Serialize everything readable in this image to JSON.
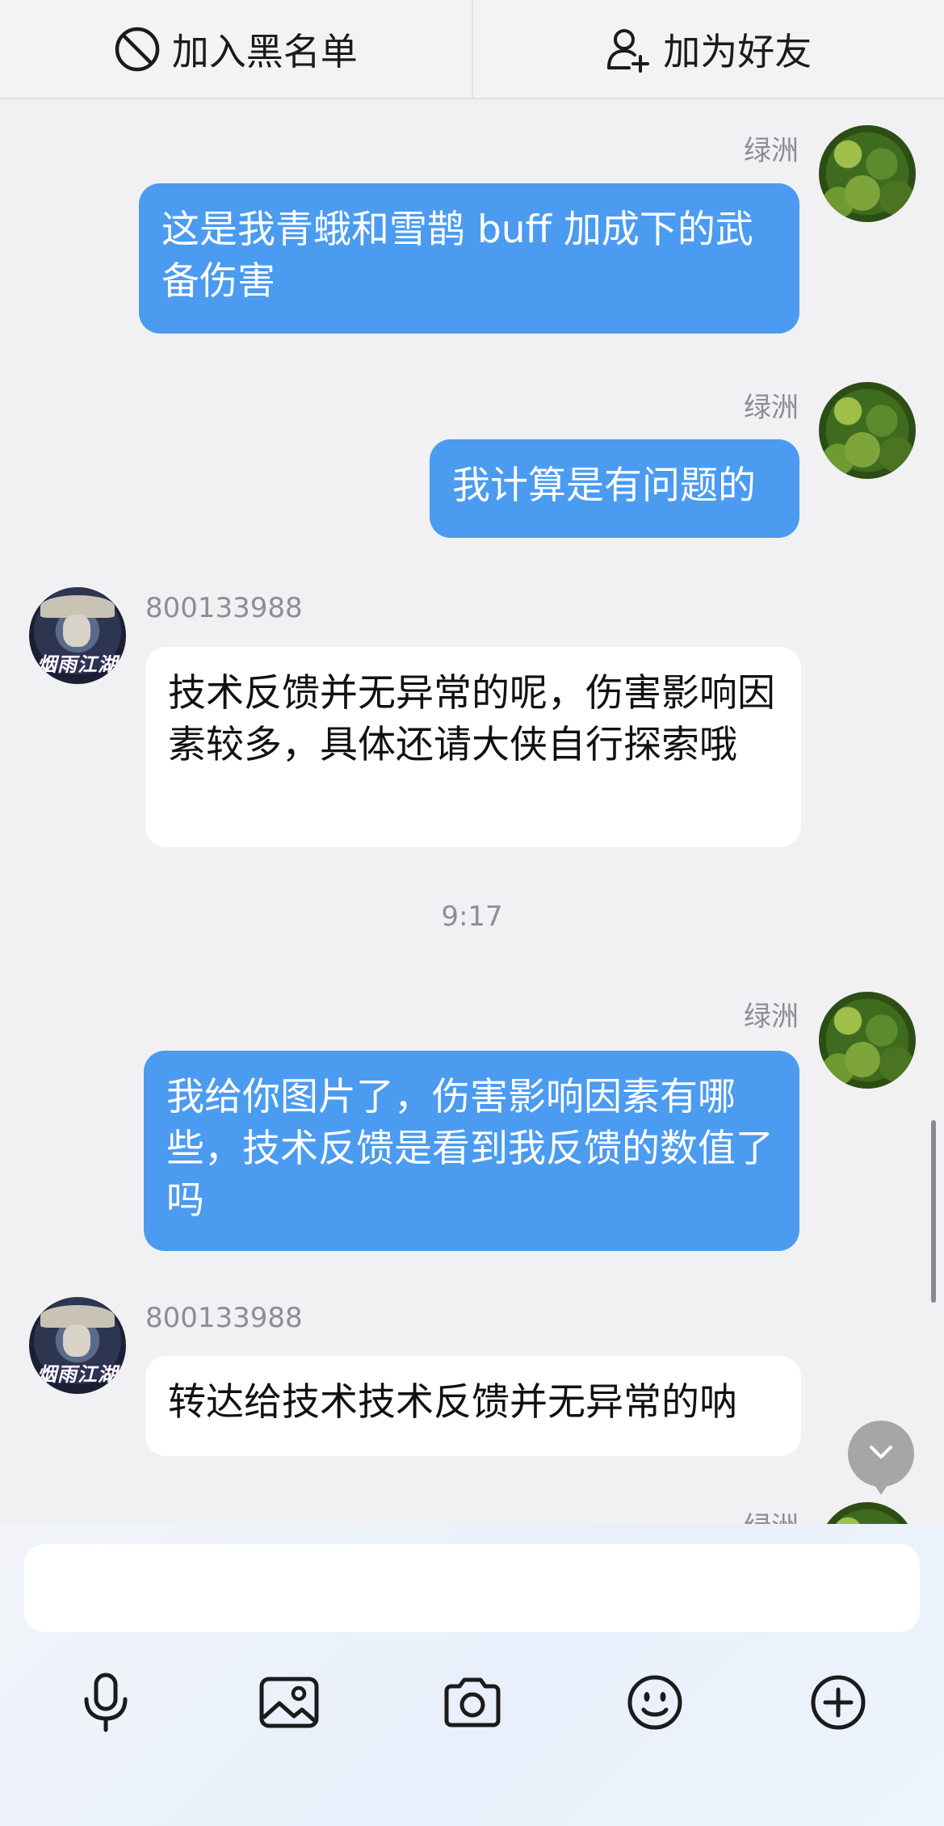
{
  "topbar": {
    "blacklist_label": "加入黑名单",
    "add_friend_label": "加为好友"
  },
  "messages": [
    {
      "sender": "绿洲",
      "side": "me",
      "text": "这是我青蛾和雪鹊 buff 加成下的武备伤害"
    },
    {
      "sender": "绿洲",
      "side": "me",
      "text": "我计算是有问题的"
    },
    {
      "sender": "800133988",
      "side": "them",
      "text": "技术反馈并无异常的呢，伤害影响因素较多，具体还请大侠自行探索哦"
    },
    {
      "sender": "绿洲",
      "side": "me",
      "text": "我给你图片了，伤害影响因素有哪些，技术反馈是看到我反馈的数值了吗"
    },
    {
      "sender": "800133988",
      "side": "them",
      "text": "转达给技术技术反馈并无异常的呐"
    },
    {
      "sender": "绿洲",
      "side": "me",
      "text": ""
    }
  ],
  "timestamp": "9:17",
  "npc_avatar_logo": "烟雨江湖",
  "composer": {
    "input_value": "",
    "tools": [
      "microphone-icon",
      "image-icon",
      "camera-icon",
      "emoji-icon",
      "plus-icon"
    ]
  },
  "colors": {
    "my_bubble": "#4b9bf1",
    "their_bubble": "#ffffff",
    "background": "#f1f1f3"
  }
}
